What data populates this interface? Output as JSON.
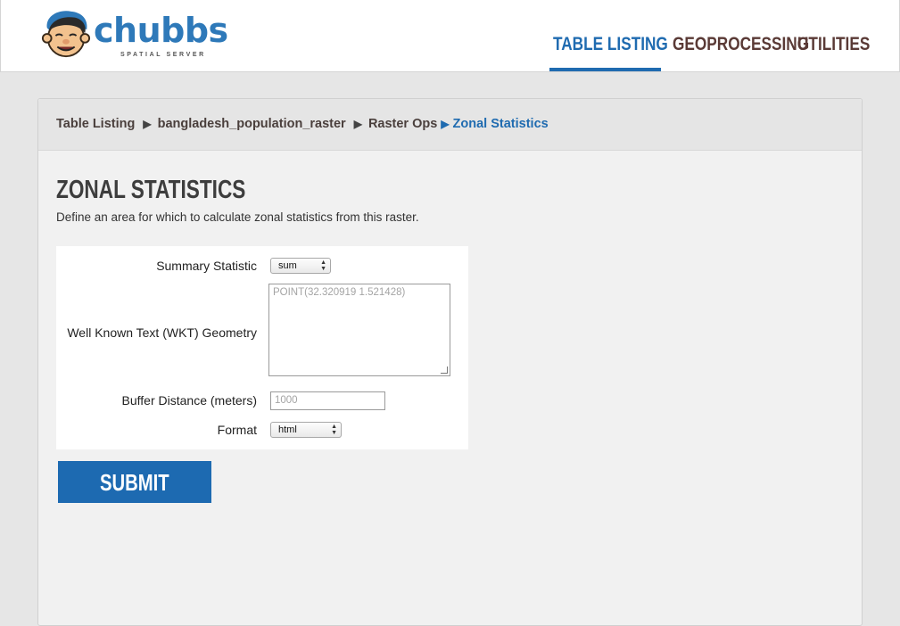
{
  "brand": {
    "name": "chubbs",
    "tagline": "SPATIAL SERVER",
    "accent_color": "#1f6bb0"
  },
  "nav": {
    "items": [
      {
        "label": "TABLE LISTING",
        "active": true
      },
      {
        "label": "GEOPROCESSING",
        "active": false
      },
      {
        "label": "UTILITIES",
        "active": false
      }
    ]
  },
  "breadcrumb": {
    "items": [
      "Table Listing",
      "bangladesh_population_raster",
      "Raster Ops",
      "Zonal Statistics"
    ]
  },
  "page": {
    "title": "ZONAL STATISTICS",
    "description": "Define an area for which to calculate zonal statistics from this raster."
  },
  "form": {
    "summary_statistic_label": "Summary Statistic",
    "summary_statistic_value": "sum",
    "wkt_label": "Well Known Text (WKT) Geometry",
    "wkt_placeholder": "POINT(32.320919 1.521428)",
    "buffer_label": "Buffer Distance (meters)",
    "buffer_placeholder": "1000",
    "format_label": "Format",
    "format_value": "html",
    "submit_label": "SUBMIT"
  }
}
